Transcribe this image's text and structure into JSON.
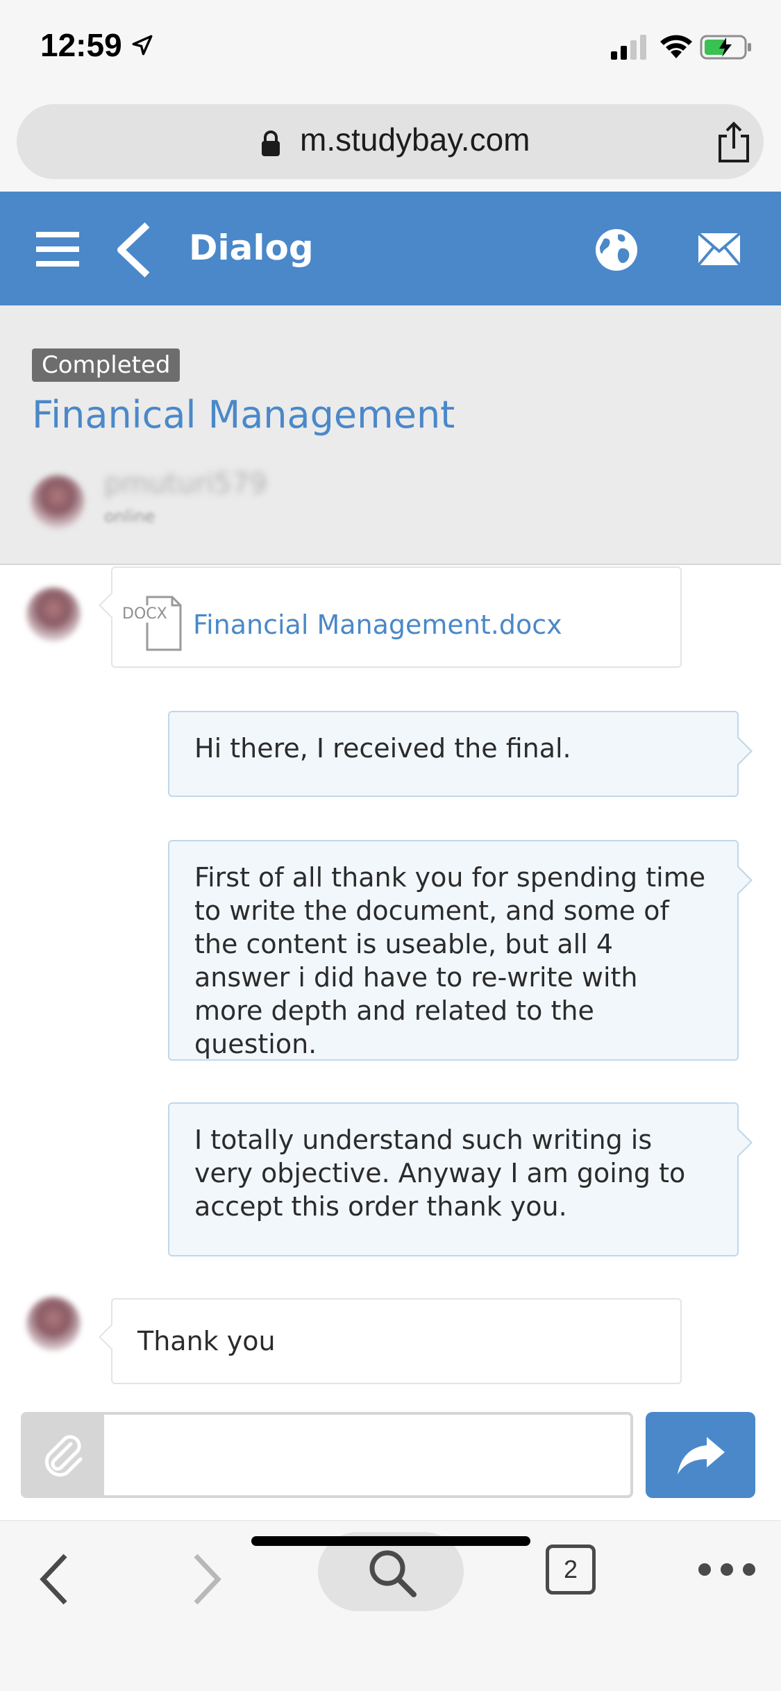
{
  "status_bar": {
    "time": "12:59"
  },
  "browser": {
    "url": "m.studybay.com"
  },
  "header": {
    "title": "Dialog"
  },
  "order": {
    "status": "Completed",
    "title": "Finanical Management",
    "user_name": "pmuturi579",
    "user_status": "online"
  },
  "messages": [
    {
      "type": "file",
      "direction": "incoming",
      "ext": "DOCX",
      "file_name": "Financial Management.docx"
    },
    {
      "type": "text",
      "direction": "outgoing",
      "text": "Hi there, I received the final."
    },
    {
      "type": "text",
      "direction": "outgoing",
      "text": "First of all thank you for spending time to write the document, and some of the content is useable, but all 4 answer i did have to re-write with more depth and related to the question."
    },
    {
      "type": "text",
      "direction": "outgoing",
      "text": "I totally understand such writing is very objective. Anyway I am going to accept this order thank you."
    },
    {
      "type": "text",
      "direction": "incoming",
      "text": "Thank you"
    }
  ],
  "composer": {
    "value": "",
    "placeholder": ""
  },
  "toolbar": {
    "tab_count": "2"
  },
  "colors": {
    "brand": "#4a88c9",
    "badge": "#6d6d6d",
    "outgoing_bubble": "#f2f7fc"
  },
  "icons": [
    "location-arrow-icon",
    "signal-icon",
    "wifi-icon",
    "battery-icon",
    "lock-icon",
    "share-icon",
    "menu-icon",
    "back-chevron-icon",
    "globe-icon",
    "mail-icon",
    "docx-file-icon",
    "paperclip-icon",
    "send-arrow-icon",
    "search-icon",
    "more-icon"
  ]
}
